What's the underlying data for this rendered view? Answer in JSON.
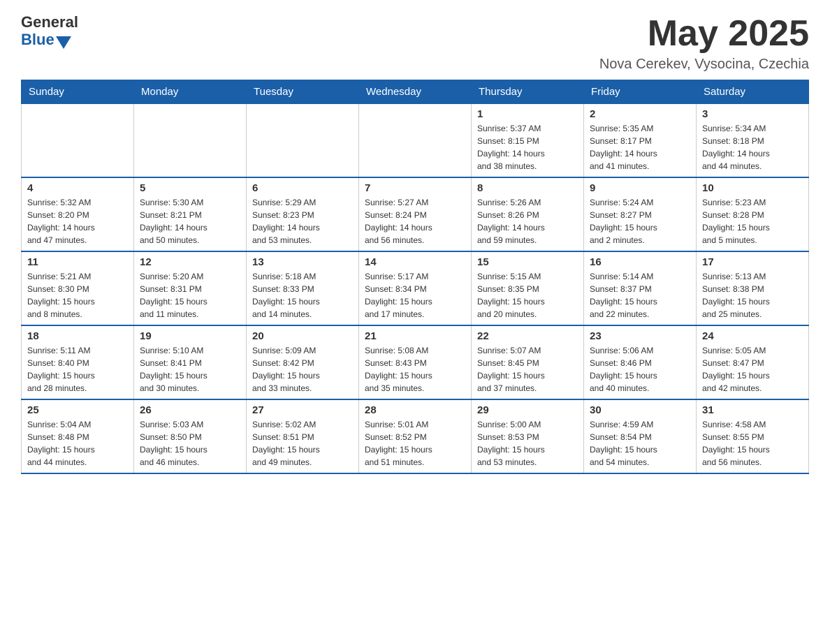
{
  "header": {
    "logo_general": "General",
    "logo_blue": "Blue",
    "month_title": "May 2025",
    "location": "Nova Cerekev, Vysocina, Czechia"
  },
  "weekdays": [
    "Sunday",
    "Monday",
    "Tuesday",
    "Wednesday",
    "Thursday",
    "Friday",
    "Saturday"
  ],
  "weeks": [
    [
      {
        "day": "",
        "info": ""
      },
      {
        "day": "",
        "info": ""
      },
      {
        "day": "",
        "info": ""
      },
      {
        "day": "",
        "info": ""
      },
      {
        "day": "1",
        "info": "Sunrise: 5:37 AM\nSunset: 8:15 PM\nDaylight: 14 hours\nand 38 minutes."
      },
      {
        "day": "2",
        "info": "Sunrise: 5:35 AM\nSunset: 8:17 PM\nDaylight: 14 hours\nand 41 minutes."
      },
      {
        "day": "3",
        "info": "Sunrise: 5:34 AM\nSunset: 8:18 PM\nDaylight: 14 hours\nand 44 minutes."
      }
    ],
    [
      {
        "day": "4",
        "info": "Sunrise: 5:32 AM\nSunset: 8:20 PM\nDaylight: 14 hours\nand 47 minutes."
      },
      {
        "day": "5",
        "info": "Sunrise: 5:30 AM\nSunset: 8:21 PM\nDaylight: 14 hours\nand 50 minutes."
      },
      {
        "day": "6",
        "info": "Sunrise: 5:29 AM\nSunset: 8:23 PM\nDaylight: 14 hours\nand 53 minutes."
      },
      {
        "day": "7",
        "info": "Sunrise: 5:27 AM\nSunset: 8:24 PM\nDaylight: 14 hours\nand 56 minutes."
      },
      {
        "day": "8",
        "info": "Sunrise: 5:26 AM\nSunset: 8:26 PM\nDaylight: 14 hours\nand 59 minutes."
      },
      {
        "day": "9",
        "info": "Sunrise: 5:24 AM\nSunset: 8:27 PM\nDaylight: 15 hours\nand 2 minutes."
      },
      {
        "day": "10",
        "info": "Sunrise: 5:23 AM\nSunset: 8:28 PM\nDaylight: 15 hours\nand 5 minutes."
      }
    ],
    [
      {
        "day": "11",
        "info": "Sunrise: 5:21 AM\nSunset: 8:30 PM\nDaylight: 15 hours\nand 8 minutes."
      },
      {
        "day": "12",
        "info": "Sunrise: 5:20 AM\nSunset: 8:31 PM\nDaylight: 15 hours\nand 11 minutes."
      },
      {
        "day": "13",
        "info": "Sunrise: 5:18 AM\nSunset: 8:33 PM\nDaylight: 15 hours\nand 14 minutes."
      },
      {
        "day": "14",
        "info": "Sunrise: 5:17 AM\nSunset: 8:34 PM\nDaylight: 15 hours\nand 17 minutes."
      },
      {
        "day": "15",
        "info": "Sunrise: 5:15 AM\nSunset: 8:35 PM\nDaylight: 15 hours\nand 20 minutes."
      },
      {
        "day": "16",
        "info": "Sunrise: 5:14 AM\nSunset: 8:37 PM\nDaylight: 15 hours\nand 22 minutes."
      },
      {
        "day": "17",
        "info": "Sunrise: 5:13 AM\nSunset: 8:38 PM\nDaylight: 15 hours\nand 25 minutes."
      }
    ],
    [
      {
        "day": "18",
        "info": "Sunrise: 5:11 AM\nSunset: 8:40 PM\nDaylight: 15 hours\nand 28 minutes."
      },
      {
        "day": "19",
        "info": "Sunrise: 5:10 AM\nSunset: 8:41 PM\nDaylight: 15 hours\nand 30 minutes."
      },
      {
        "day": "20",
        "info": "Sunrise: 5:09 AM\nSunset: 8:42 PM\nDaylight: 15 hours\nand 33 minutes."
      },
      {
        "day": "21",
        "info": "Sunrise: 5:08 AM\nSunset: 8:43 PM\nDaylight: 15 hours\nand 35 minutes."
      },
      {
        "day": "22",
        "info": "Sunrise: 5:07 AM\nSunset: 8:45 PM\nDaylight: 15 hours\nand 37 minutes."
      },
      {
        "day": "23",
        "info": "Sunrise: 5:06 AM\nSunset: 8:46 PM\nDaylight: 15 hours\nand 40 minutes."
      },
      {
        "day": "24",
        "info": "Sunrise: 5:05 AM\nSunset: 8:47 PM\nDaylight: 15 hours\nand 42 minutes."
      }
    ],
    [
      {
        "day": "25",
        "info": "Sunrise: 5:04 AM\nSunset: 8:48 PM\nDaylight: 15 hours\nand 44 minutes."
      },
      {
        "day": "26",
        "info": "Sunrise: 5:03 AM\nSunset: 8:50 PM\nDaylight: 15 hours\nand 46 minutes."
      },
      {
        "day": "27",
        "info": "Sunrise: 5:02 AM\nSunset: 8:51 PM\nDaylight: 15 hours\nand 49 minutes."
      },
      {
        "day": "28",
        "info": "Sunrise: 5:01 AM\nSunset: 8:52 PM\nDaylight: 15 hours\nand 51 minutes."
      },
      {
        "day": "29",
        "info": "Sunrise: 5:00 AM\nSunset: 8:53 PM\nDaylight: 15 hours\nand 53 minutes."
      },
      {
        "day": "30",
        "info": "Sunrise: 4:59 AM\nSunset: 8:54 PM\nDaylight: 15 hours\nand 54 minutes."
      },
      {
        "day": "31",
        "info": "Sunrise: 4:58 AM\nSunset: 8:55 PM\nDaylight: 15 hours\nand 56 minutes."
      }
    ]
  ]
}
